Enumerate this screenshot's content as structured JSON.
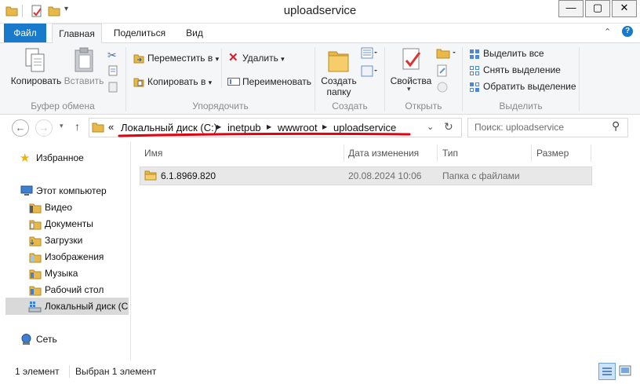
{
  "window": {
    "title": "uploadservice"
  },
  "tabs": [
    {
      "label": "Файл"
    },
    {
      "label": "Главная"
    },
    {
      "label": "Поделиться"
    },
    {
      "label": "Вид"
    }
  ],
  "ribbon": {
    "clipboard": {
      "copy": "Копировать",
      "paste": "Вставить",
      "label": "Буфер обмена"
    },
    "organize": {
      "move_to": "Переместить в",
      "copy_to": "Копировать в",
      "delete": "Удалить",
      "rename": "Переименовать",
      "label": "Упорядочить"
    },
    "create": {
      "new_folder_line1": "Создать",
      "new_folder_line2": "папку",
      "label": "Создать"
    },
    "open": {
      "properties": "Свойства",
      "label": "Открыть"
    },
    "select": {
      "select_all": "Выделить все",
      "select_none": "Снять выделение",
      "invert": "Обратить выделение",
      "label": "Выделить"
    }
  },
  "address": {
    "overflow": "«",
    "crumbs": [
      "Локальный диск (C:)",
      "inetpub",
      "wwwroot",
      "uploadservice"
    ],
    "search_placeholder": "Поиск: uploadservice"
  },
  "nav": {
    "favorites": "Избранное",
    "this_pc": "Этот компьютер",
    "items": [
      "Видео",
      "Документы",
      "Загрузки",
      "Изображения",
      "Музыка",
      "Рабочий стол",
      "Локальный диск (C"
    ],
    "network": "Сеть"
  },
  "columns": [
    "Имя",
    "Дата изменения",
    "Тип",
    "Размер"
  ],
  "files": [
    {
      "name": "6.1.8969.820",
      "modified": "20.08.2024 10:06",
      "type": "Папка с файлами",
      "size": ""
    }
  ],
  "status": {
    "count": "1 элемент",
    "selected": "Выбран 1 элемент"
  },
  "colors": {
    "file_tab": "#1979ca",
    "folder": "#e8b84a",
    "underline": "#e3000f"
  }
}
